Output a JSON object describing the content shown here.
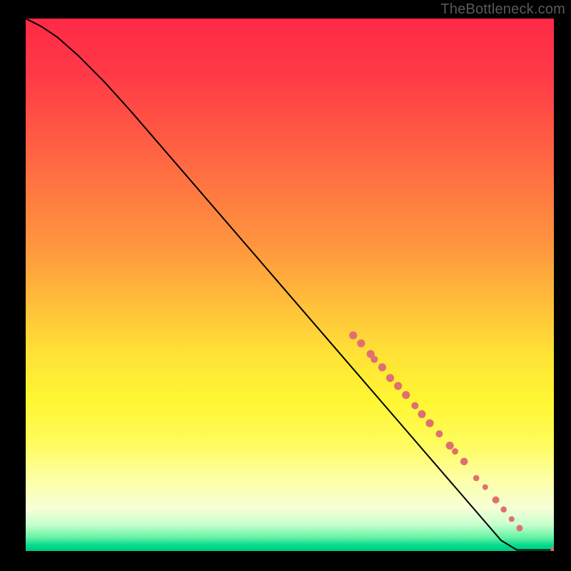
{
  "watermark": "TheBottleneck.com",
  "chart_data": {
    "type": "line",
    "title": "",
    "xlabel": "",
    "ylabel": "",
    "xlim": [
      0,
      100
    ],
    "ylim": [
      0,
      100
    ],
    "grid": false,
    "legend": false,
    "curve": [
      {
        "x": 0,
        "y": 100
      },
      {
        "x": 3,
        "y": 98.5
      },
      {
        "x": 6,
        "y": 96.5
      },
      {
        "x": 10,
        "y": 93
      },
      {
        "x": 15,
        "y": 88
      },
      {
        "x": 20,
        "y": 82.5
      },
      {
        "x": 30,
        "y": 71
      },
      {
        "x": 40,
        "y": 59.5
      },
      {
        "x": 50,
        "y": 48
      },
      {
        "x": 60,
        "y": 36.5
      },
      {
        "x": 70,
        "y": 25
      },
      {
        "x": 80,
        "y": 13.5
      },
      {
        "x": 90,
        "y": 2
      },
      {
        "x": 93,
        "y": 0.2
      },
      {
        "x": 95.5,
        "y": 0.2
      },
      {
        "x": 100,
        "y": 0.2
      }
    ],
    "markers": [
      {
        "x": 62,
        "y": 40.5,
        "r": 5.6
      },
      {
        "x": 63.5,
        "y": 39,
        "r": 5.6
      },
      {
        "x": 65.3,
        "y": 37,
        "r": 5.6
      },
      {
        "x": 66,
        "y": 36,
        "r": 5.0
      },
      {
        "x": 67.5,
        "y": 34.5,
        "r": 5.6
      },
      {
        "x": 69,
        "y": 32.5,
        "r": 5.6
      },
      {
        "x": 70.5,
        "y": 31,
        "r": 5.6
      },
      {
        "x": 72,
        "y": 29.3,
        "r": 5.6
      },
      {
        "x": 73.7,
        "y": 27.3,
        "r": 5.0
      },
      {
        "x": 75,
        "y": 25.7,
        "r": 5.6
      },
      {
        "x": 76.5,
        "y": 24,
        "r": 5.6
      },
      {
        "x": 78.3,
        "y": 22,
        "r": 5.0
      },
      {
        "x": 80.3,
        "y": 19.8,
        "r": 5.6
      },
      {
        "x": 81.3,
        "y": 18.7,
        "r": 4.5
      },
      {
        "x": 83,
        "y": 16.8,
        "r": 5.3
      },
      {
        "x": 85.3,
        "y": 13.7,
        "r": 4.3
      },
      {
        "x": 87,
        "y": 12,
        "r": 4.0
      },
      {
        "x": 89,
        "y": 9.6,
        "r": 5.0
      },
      {
        "x": 90.5,
        "y": 7.8,
        "r": 4.3
      },
      {
        "x": 92,
        "y": 6,
        "r": 4.0
      },
      {
        "x": 93.5,
        "y": 4.3,
        "r": 4.5
      },
      {
        "x": 100,
        "y": 0.2,
        "r": 4.5
      }
    ],
    "marker_color": "#e07070",
    "curve_color": "#000000"
  }
}
